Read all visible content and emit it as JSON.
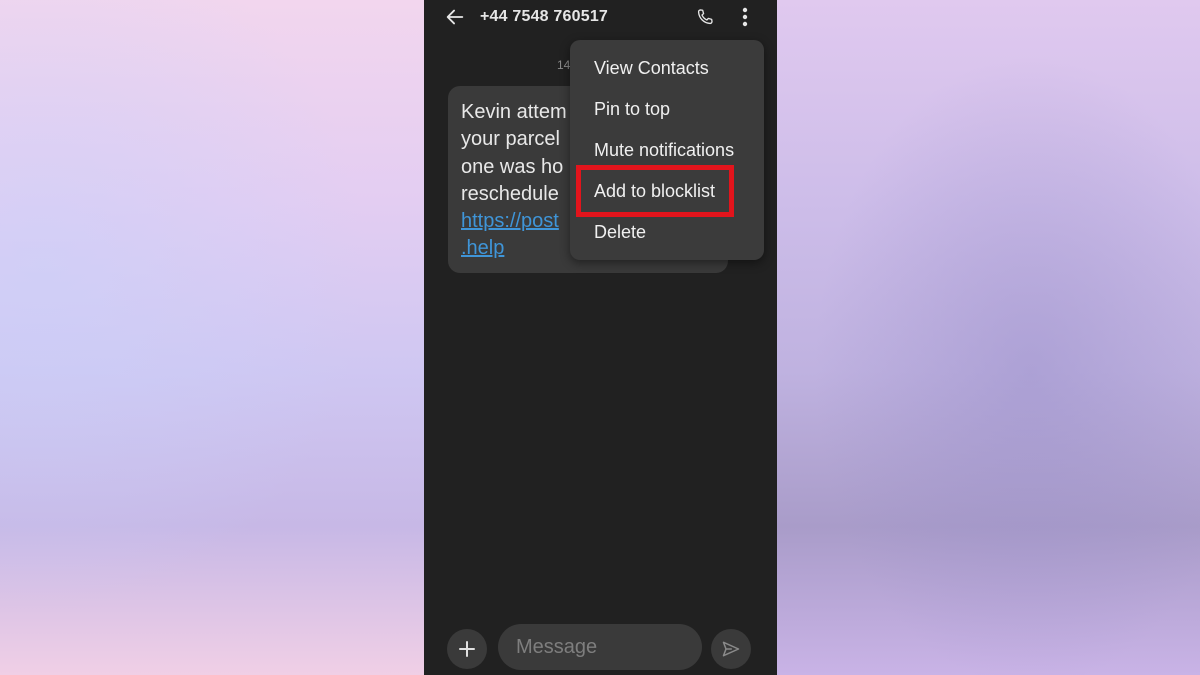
{
  "header": {
    "title": "+44 7548 760517",
    "back_icon": "arrow-left-icon",
    "call_icon": "phone-icon",
    "more_icon": "more-vert-icon"
  },
  "conversation": {
    "timestamp": "14",
    "message": {
      "text": "Kevin attem\nyour parcel\none was ho\nreschedule",
      "link": "https://post\n.help"
    }
  },
  "menu": {
    "items": [
      "View Contacts",
      "Pin to top",
      "Mute notifications",
      "Add to blocklist",
      "Delete"
    ],
    "highlighted": "Add to blocklist",
    "highlight_color": "#e2141c"
  },
  "composer": {
    "placeholder": "Message",
    "add_icon": "plus-icon",
    "send_icon": "send-icon"
  },
  "colors": {
    "screen_bg": "#212121",
    "bubble_bg": "#3a3a3a",
    "link": "#3f95d8"
  }
}
